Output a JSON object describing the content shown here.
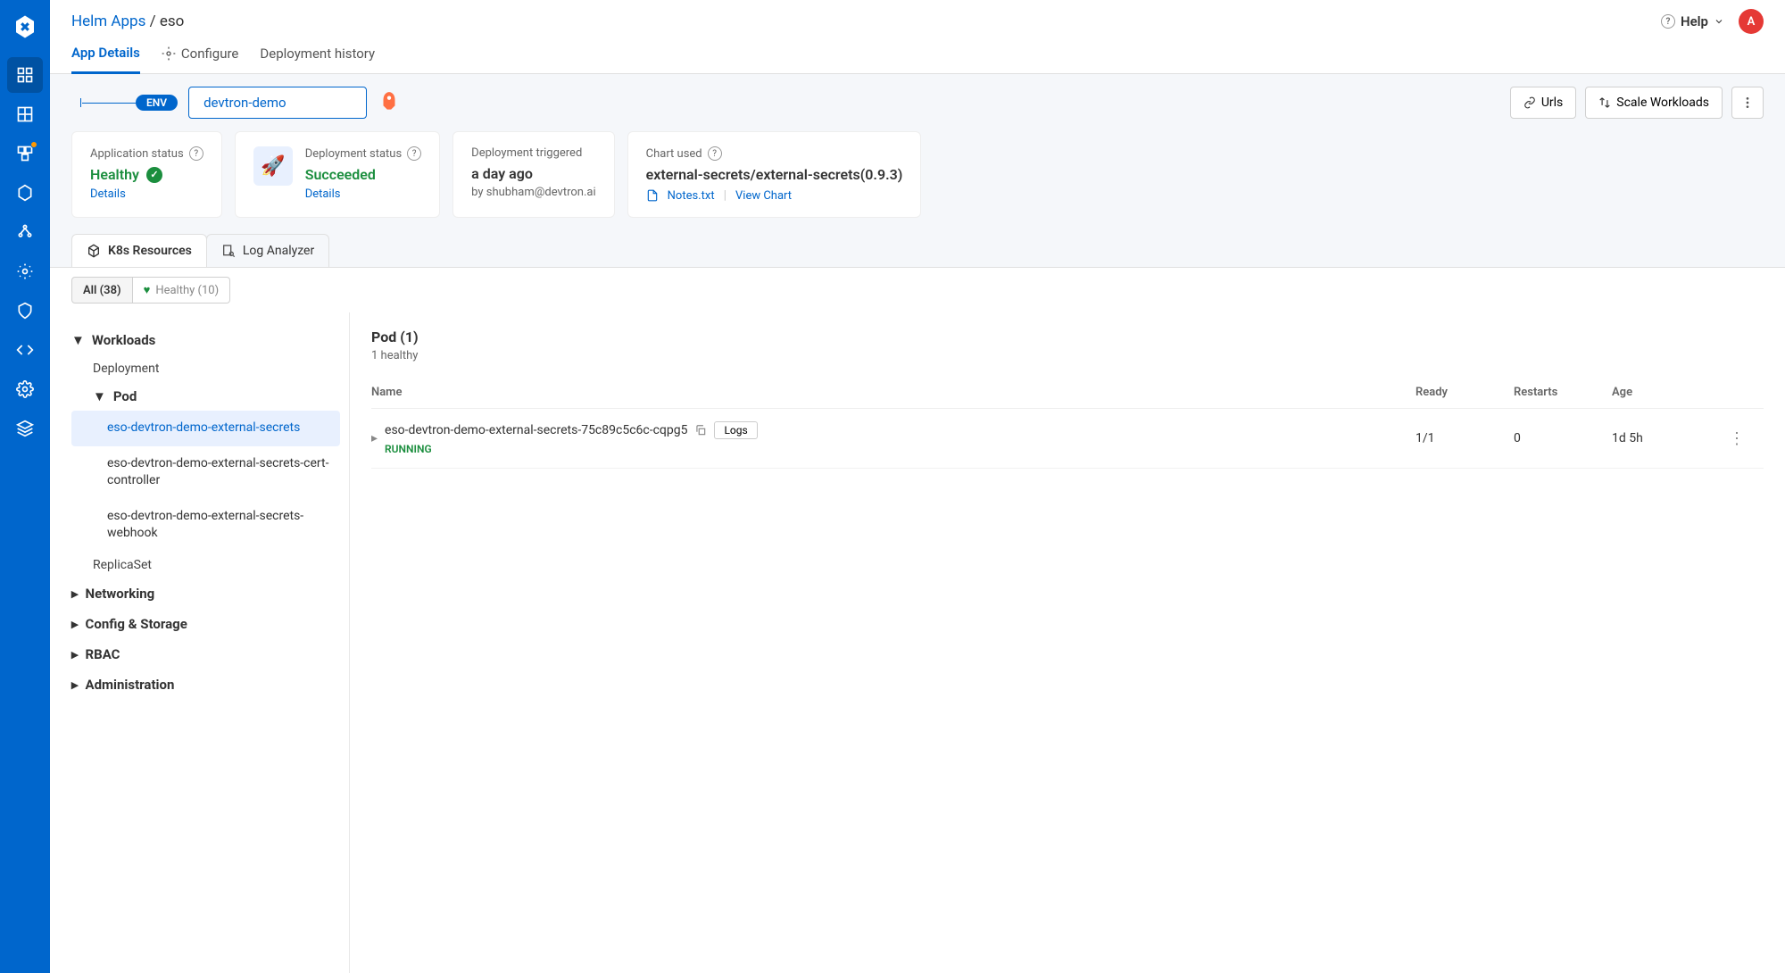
{
  "breadcrumb": {
    "root": "Helm Apps",
    "sep": " / ",
    "current": "eso"
  },
  "topbar": {
    "help": "Help",
    "avatar": "A"
  },
  "tabs": {
    "app_details": "App Details",
    "configure": "Configure",
    "deployment_history": "Deployment history"
  },
  "env": {
    "label": "ENV",
    "selected": "devtron-demo",
    "urls": "Urls",
    "scale": "Scale Workloads"
  },
  "cards": {
    "app_status": {
      "label": "Application status",
      "value": "Healthy",
      "details": "Details"
    },
    "dep_status": {
      "label": "Deployment status",
      "value": "Succeeded",
      "details": "Details"
    },
    "dep_trig": {
      "label": "Deployment triggered",
      "time": "a day ago",
      "by_prefix": "by ",
      "by": "shubham@devtron.ai"
    },
    "chart": {
      "label": "Chart used",
      "value": "external-secrets/external-secrets(0.9.3)",
      "notes": "Notes.txt",
      "view": "View Chart"
    }
  },
  "subtabs": {
    "k8s": "K8s Resources",
    "log": "Log Analyzer"
  },
  "filters": {
    "all": "All (38)",
    "healthy": "Healthy (10)"
  },
  "tree": {
    "workloads": "Workloads",
    "deployment": "Deployment",
    "pod": "Pod",
    "pods": [
      "eso-devtron-demo-external-secrets",
      "eso-devtron-demo-external-secrets-cert-controller",
      "eso-devtron-demo-external-secrets-webhook"
    ],
    "replicaset": "ReplicaSet",
    "networking": "Networking",
    "config_storage": "Config & Storage",
    "rbac": "RBAC",
    "administration": "Administration"
  },
  "detail": {
    "title": "Pod (1)",
    "sub": "1 healthy",
    "cols": {
      "name": "Name",
      "ready": "Ready",
      "restarts": "Restarts",
      "age": "Age"
    },
    "row": {
      "name": "eso-devtron-demo-external-secrets-75c89c5c6c-cqpg5",
      "logs": "Logs",
      "status": "RUNNING",
      "ready": "1/1",
      "restarts": "0",
      "age": "1d 5h"
    }
  }
}
